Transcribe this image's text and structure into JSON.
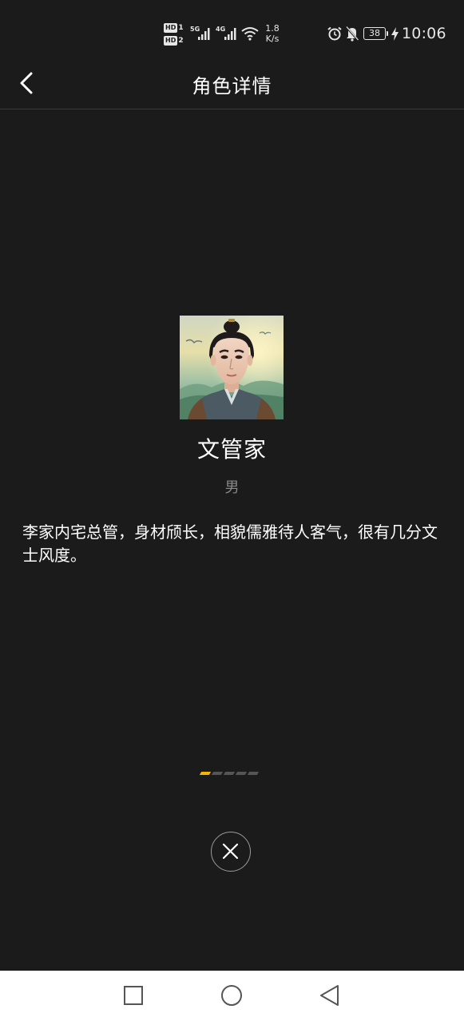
{
  "status_bar": {
    "sim1": {
      "tag": "HD",
      "num": "1"
    },
    "sim2": {
      "tag": "HD",
      "num": "2"
    },
    "network1": "5G",
    "network2": "4G",
    "speed_value": "1.8",
    "speed_unit": "K/s",
    "battery": "38",
    "time": "10:06",
    "icons": [
      "alarm-icon",
      "mute-bell-icon",
      "wifi-icon",
      "charging-bolt-icon"
    ]
  },
  "header": {
    "title": "角色详情",
    "back_icon": "chevron-left-icon"
  },
  "character": {
    "name": "文管家",
    "gender": "男",
    "description": "李家内宅总管，身材颀长，相貌儒雅待人客气，很有几分文士风度。"
  },
  "pager": {
    "count": 5,
    "active_index": 0,
    "active_color": "#f4b400",
    "inactive_color": "#555555"
  },
  "close": {
    "icon": "close-icon"
  },
  "nav_bar": {
    "buttons": [
      "recent-apps-icon",
      "home-icon",
      "back-triangle-icon"
    ]
  }
}
